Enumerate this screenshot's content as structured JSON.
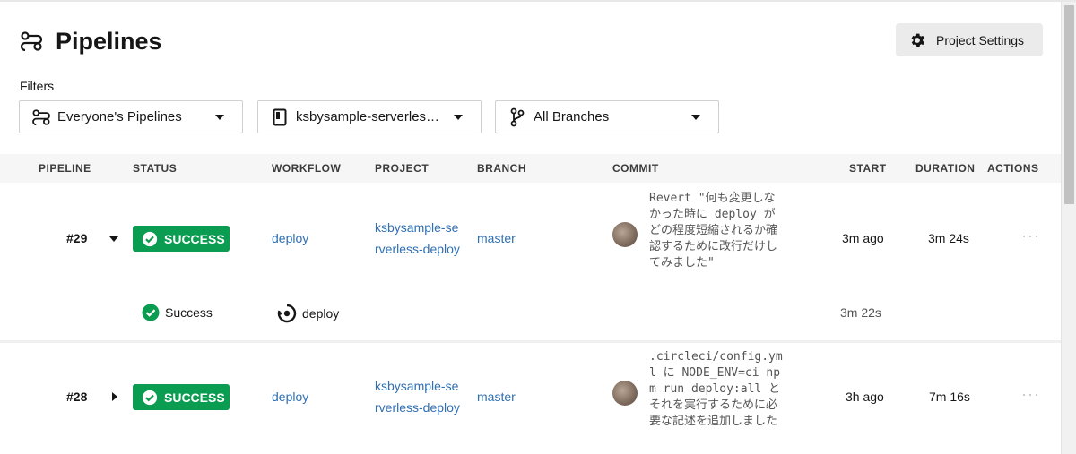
{
  "header": {
    "title": "Pipelines",
    "settings_label": "Project Settings"
  },
  "filters": {
    "label": "Filters",
    "pipelines": "Everyone's Pipelines",
    "project": "ksbysample-serverles…",
    "branches": "All Branches"
  },
  "table": {
    "columns": [
      "PIPELINE",
      "STATUS",
      "WORKFLOW",
      "PROJECT",
      "BRANCH",
      "COMMIT",
      "START",
      "DURATION",
      "ACTIONS"
    ]
  },
  "rows": [
    {
      "number": "#29",
      "status": "SUCCESS",
      "workflow": "deploy",
      "project_line1": "ksbysample-se",
      "project_line2": "rverless-deploy",
      "branch": "master",
      "commit": "Revert \"何も変更しなかった時に deploy がどの程度短縮されるか確認するために改行だけしてみました\"",
      "start": "3m ago",
      "duration": "3m 24s",
      "expanded": true,
      "workflow_detail": {
        "status": "Success",
        "name": "deploy",
        "duration": "3m 22s"
      }
    },
    {
      "number": "#28",
      "status": "SUCCESS",
      "workflow": "deploy",
      "project_line1": "ksbysample-se",
      "project_line2": "rverless-deploy",
      "branch": "master",
      "commit": ".circleci/config.yml に NODE_ENV=ci npm run deploy:all とそれを実行するために必要な記述を追加しました",
      "start": "3h ago",
      "duration": "7m 16s",
      "expanded": false
    }
  ],
  "colors": {
    "success": "#0a9c50",
    "link": "#2f6fb3"
  }
}
